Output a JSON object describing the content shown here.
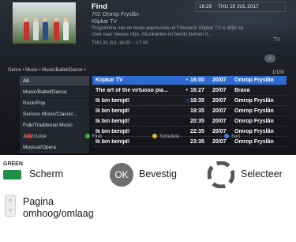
{
  "header": {
    "title": "Find",
    "channel": "702 Omrop Fryslân",
    "programme": "Klipkar TV",
    "description": "Programma met de beste popmuziek uit Friesland. Klipkar TV is altijd op zoek naar nieuwe clips. Muzikanten en bands kunnen h...",
    "time_range": "THU 20 JUL 16:00 ~ 17:00",
    "clock_time": "16:29",
    "clock_date": "THU 20 JUL 2017",
    "tv_badge": "TV",
    "round_button": "♫"
  },
  "breadcrumb": "Genre • Music • Music/Ballet/Dance •",
  "count": "1/100",
  "genres": [
    {
      "label": "All",
      "active": true
    },
    {
      "label": "Music/Ballet/Dance",
      "active": false
    },
    {
      "label": "Rock/Pop",
      "active": false
    },
    {
      "label": "Serious Music/Classic...",
      "active": false
    },
    {
      "label": "Folk/Traditional Music",
      "active": false
    },
    {
      "label": "Jazz",
      "active": false
    },
    {
      "label": "Musical/Opera",
      "active": false
    }
  ],
  "results": [
    {
      "title": "Klipkar TV",
      "icon": "●",
      "time": "16:00",
      "date": "20/07",
      "channel": "Omrop Fryslân",
      "selected": true
    },
    {
      "title": "The art of the virtuoso pia...",
      "icon": "●",
      "time": "16:27",
      "date": "20/07",
      "channel": "Brava",
      "selected": false
    },
    {
      "title": "Ik bin benijd!",
      "icon": "◷",
      "time": "18:35",
      "date": "20/07",
      "channel": "Omrop Fryslân",
      "selected": false
    },
    {
      "title": "Ik bin benijd!",
      "icon": "",
      "time": "19:35",
      "date": "20/07",
      "channel": "Omrop Fryslân",
      "selected": false
    },
    {
      "title": "Ik bin benijd!",
      "icon": "",
      "time": "20:35",
      "date": "20/07",
      "channel": "Omrop Fryslân",
      "selected": false
    },
    {
      "title": "Ik bin benijd!",
      "icon": "",
      "time": "22:35",
      "date": "20/07",
      "channel": "Omrop Fryslân",
      "selected": false
    },
    {
      "title": "Ik bin benijd!",
      "icon": "",
      "time": "23:35",
      "date": "20/07",
      "channel": "Omrop Fryslân",
      "selected": false
    }
  ],
  "legend": {
    "guide": "Guide",
    "find": "Find",
    "schedule": "Schedule",
    "sort": "Sort"
  },
  "colors": {
    "selection": "#2f6ad2",
    "red": "#d8333b",
    "green": "#3fb24a",
    "yellow": "#d8b23a",
    "blue": "#3d7ee8"
  },
  "help": {
    "green_label": "GREEN",
    "screen": "Scherm",
    "ok_key": "OK",
    "confirm": "Bevestig",
    "select": "Selecteer",
    "page": "Pagina",
    "page_updown": "omhoog/omlaag"
  }
}
